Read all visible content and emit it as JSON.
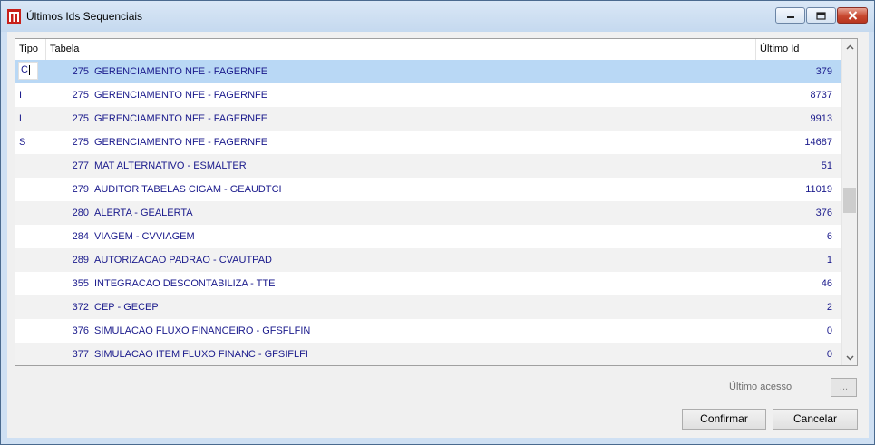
{
  "window": {
    "title": "Últimos Ids Sequenciais"
  },
  "grid": {
    "headers": {
      "tipo": "Tipo",
      "tabela": "Tabela",
      "ultimo_id": "Último Id"
    },
    "rows": [
      {
        "tipo": "C",
        "num": "275",
        "nome": "GERENCIAMENTO NFE - FAGERNFE",
        "id": "379"
      },
      {
        "tipo": "I",
        "num": "275",
        "nome": "GERENCIAMENTO NFE - FAGERNFE",
        "id": "8737"
      },
      {
        "tipo": "L",
        "num": "275",
        "nome": "GERENCIAMENTO NFE - FAGERNFE",
        "id": "9913"
      },
      {
        "tipo": "S",
        "num": "275",
        "nome": "GERENCIAMENTO NFE - FAGERNFE",
        "id": "14687"
      },
      {
        "tipo": "",
        "num": "277",
        "nome": "MAT ALTERNATIVO - ESMALTER",
        "id": "51"
      },
      {
        "tipo": "",
        "num": "279",
        "nome": "AUDITOR TABELAS CIGAM - GEAUDTCI",
        "id": "11019"
      },
      {
        "tipo": "",
        "num": "280",
        "nome": "ALERTA - GEALERTA",
        "id": "376"
      },
      {
        "tipo": "",
        "num": "284",
        "nome": "VIAGEM - CVVIAGEM",
        "id": "6"
      },
      {
        "tipo": "",
        "num": "289",
        "nome": "AUTORIZACAO PADRAO - CVAUTPAD",
        "id": "1"
      },
      {
        "tipo": "",
        "num": "355",
        "nome": "INTEGRACAO DESCONTABILIZA - TTE",
        "id": "46"
      },
      {
        "tipo": "",
        "num": "372",
        "nome": "CEP - GECEP",
        "id": "2"
      },
      {
        "tipo": "",
        "num": "376",
        "nome": "SIMULACAO FLUXO FINANCEIRO - GFSFLFIN",
        "id": "0"
      },
      {
        "tipo": "",
        "num": "377",
        "nome": "SIMULACAO ITEM FLUXO FINANC - GFSIFLFI",
        "id": "0"
      }
    ]
  },
  "footer": {
    "last_access_label": "Último acesso",
    "dots_label": "...",
    "confirm_label": "Confirmar",
    "cancel_label": "Cancelar"
  },
  "colors": {
    "selected_row": "#b9d8f5",
    "row_text": "#1a1a8c"
  },
  "icons": {
    "app": "cigam-logo-icon",
    "minimize": "minimize-icon",
    "maximize": "maximize-icon",
    "close": "close-icon",
    "scroll_up": "chevron-up-icon",
    "scroll_down": "chevron-down-icon"
  }
}
